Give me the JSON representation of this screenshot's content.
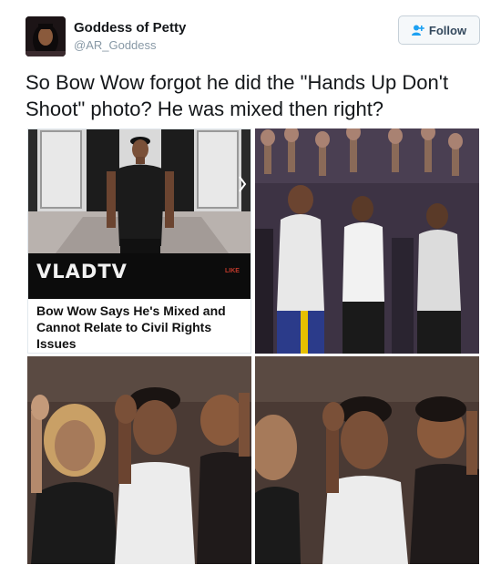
{
  "user": {
    "display_name": "Goddess of Petty",
    "handle": "@AR_Goddess"
  },
  "follow_button": {
    "label": "Follow",
    "icon": "add-user-icon"
  },
  "tweet": {
    "text": "So Bow Wow forgot he did the \"Hands Up Don't Shoot\" photo? He was mixed then right?"
  },
  "media": {
    "article_card": {
      "logo": "VLADTV",
      "like_label": "LIKE",
      "headline": "Bow Wow Says He's Mixed and Cannot Relate to Civil Rights Issues"
    }
  },
  "colors": {
    "follow_border": "#c6d0d8",
    "follow_text": "#34495e",
    "handle_gray": "#8899a6"
  }
}
